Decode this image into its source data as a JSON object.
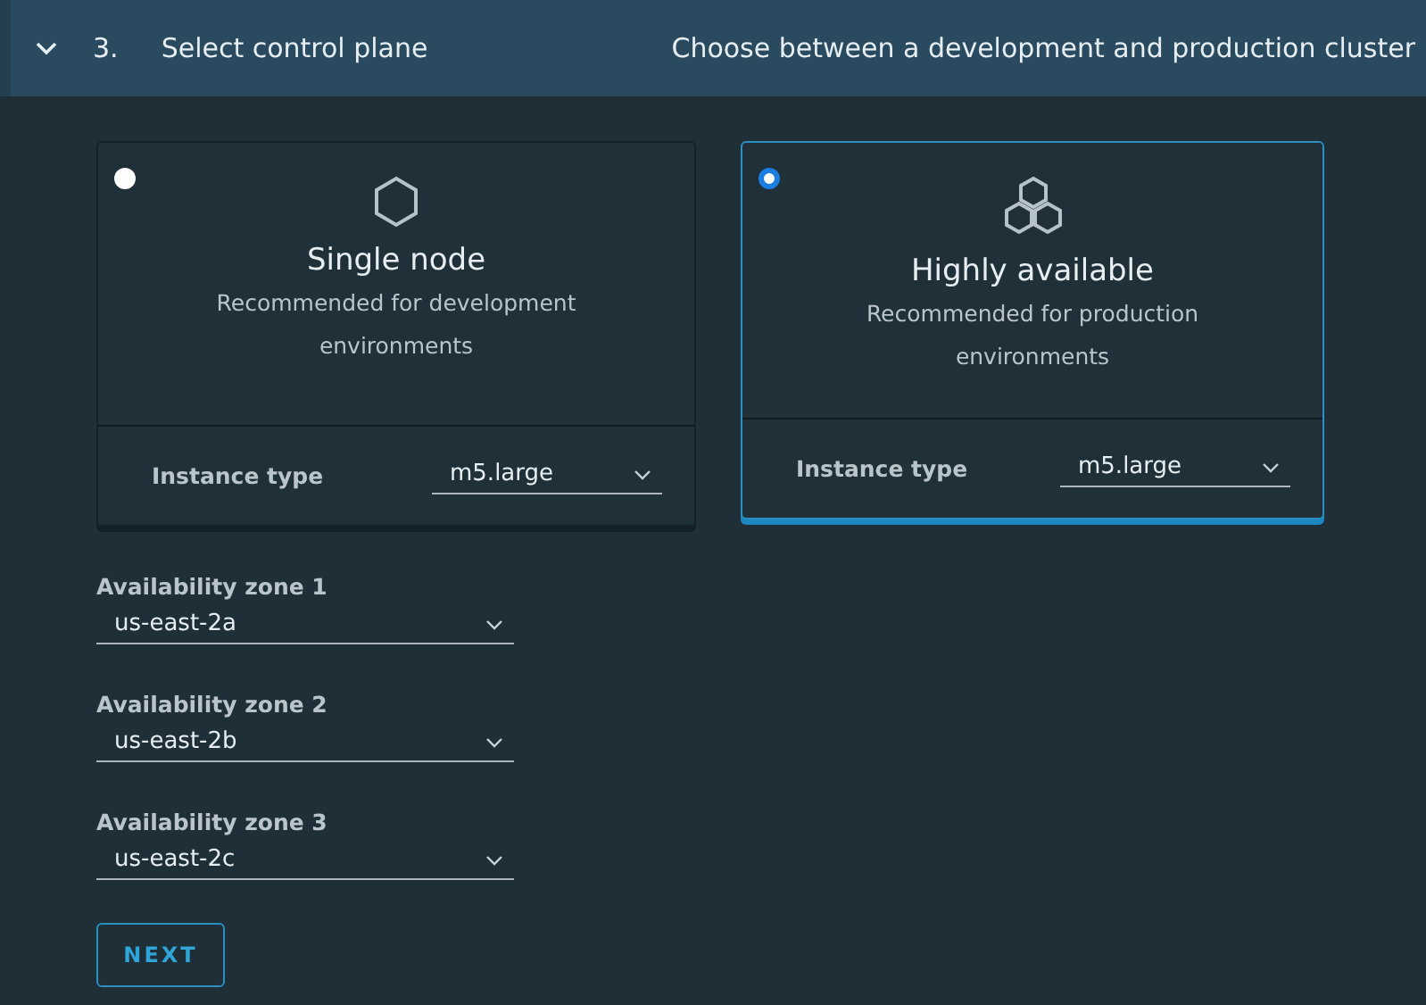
{
  "step": {
    "expanded": true,
    "number": "3.",
    "title": "Select control plane",
    "description": "Choose between a development and production cluster"
  },
  "options": [
    {
      "kind": "single",
      "selected": false,
      "title": "Single node",
      "description": "Recommended for development environments",
      "instance_label": "Instance type",
      "instance_value": "m5.large"
    },
    {
      "kind": "ha",
      "selected": true,
      "title": "Highly available",
      "description": "Recommended for production environments",
      "instance_label": "Instance type",
      "instance_value": "m5.large"
    }
  ],
  "zones": [
    {
      "label": "Availability zone 1",
      "value": "us-east-2a"
    },
    {
      "label": "Availability zone 2",
      "value": "us-east-2b"
    },
    {
      "label": "Availability zone 3",
      "value": "us-east-2c"
    }
  ],
  "next_button": "NEXT"
}
